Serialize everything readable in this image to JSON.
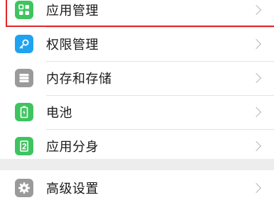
{
  "menu": {
    "items": [
      {
        "label": "应用管理",
        "icon": "app-grid-icon",
        "color": "#3ec45f"
      },
      {
        "label": "权限管理",
        "icon": "key-icon",
        "color": "#1fa3f0"
      },
      {
        "label": "内存和存储",
        "icon": "storage-icon",
        "color": "#9a9a9a"
      },
      {
        "label": "电池",
        "icon": "battery-icon",
        "color": "#3ec45f"
      },
      {
        "label": "应用分身",
        "icon": "app-clone-icon",
        "color": "#3ec45f"
      }
    ],
    "advanced": {
      "label": "高级设置",
      "icon": "gear-icon",
      "color": "#9a9a9a"
    }
  },
  "highlight_color": "#e0252a"
}
